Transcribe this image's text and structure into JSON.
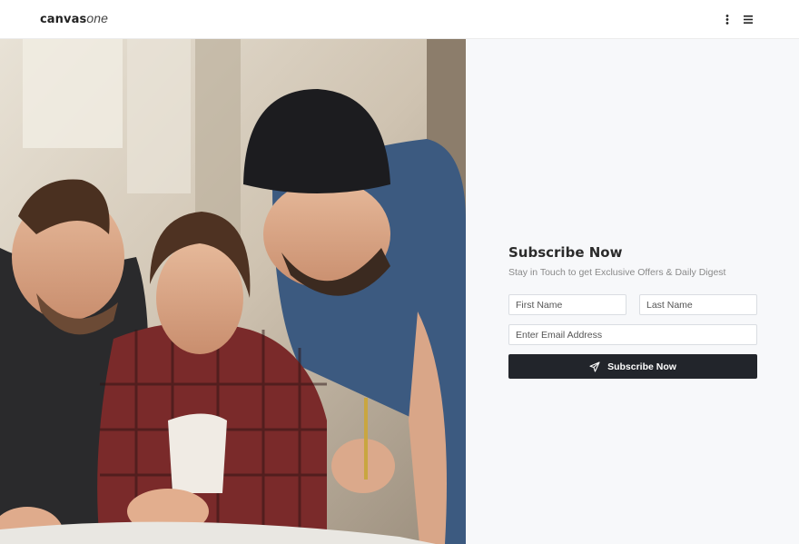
{
  "header": {
    "logo_main": "canvas",
    "logo_accent": "one",
    "kebab_icon": "more-vertical-icon",
    "menu_icon": "hamburger-menu-icon"
  },
  "hero": {
    "image_subject": "team-collaborating-photo"
  },
  "subscribe": {
    "title": "Subscribe Now",
    "description": "Stay in Touch to get Exclusive Offers & Daily Digest",
    "first_name_placeholder": "First Name",
    "last_name_placeholder": "Last Name",
    "email_placeholder": "Enter Email Address",
    "button_label": "Subscribe Now",
    "button_icon": "paper-plane-icon"
  },
  "colors": {
    "button_bg": "#22252b",
    "panel_bg": "#f7f8fa"
  }
}
